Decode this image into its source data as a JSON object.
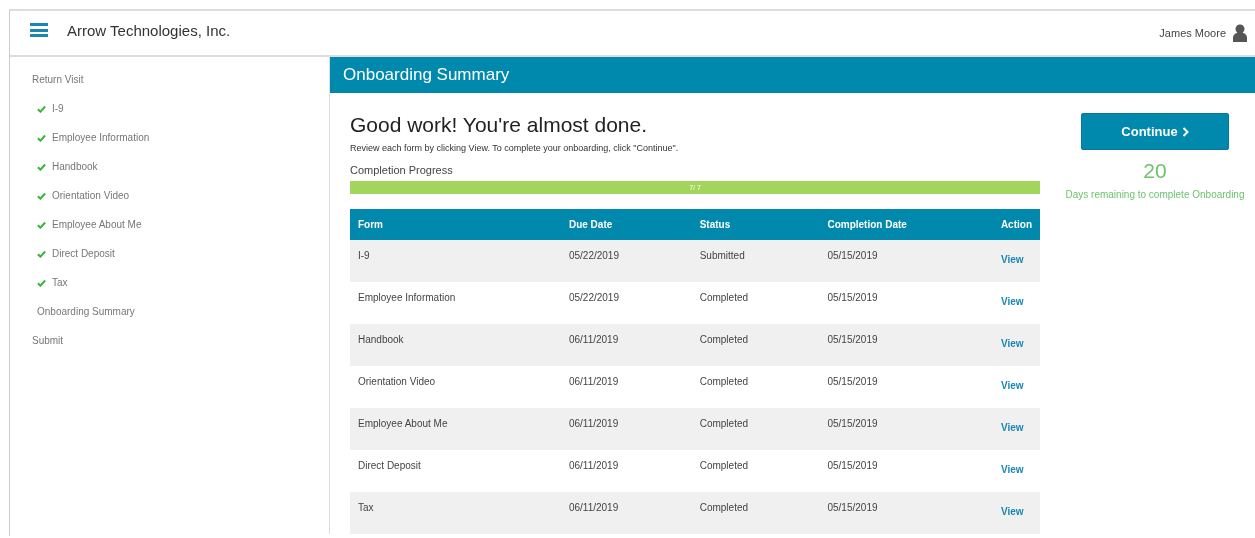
{
  "header": {
    "company": "Arrow Technologies, Inc.",
    "user": "James Moore"
  },
  "sidebar": {
    "items": [
      {
        "label": "Return Visit",
        "completed": false,
        "kind": "link"
      },
      {
        "label": "I-9",
        "completed": true,
        "kind": "step"
      },
      {
        "label": "Employee Information",
        "completed": true,
        "kind": "step"
      },
      {
        "label": "Handbook",
        "completed": true,
        "kind": "step"
      },
      {
        "label": "Orientation Video",
        "completed": true,
        "kind": "step"
      },
      {
        "label": "Employee About Me",
        "completed": true,
        "kind": "step"
      },
      {
        "label": "Direct Deposit",
        "completed": true,
        "kind": "step"
      },
      {
        "label": "Tax",
        "completed": true,
        "kind": "step"
      },
      {
        "label": "Onboarding Summary",
        "completed": false,
        "kind": "step"
      },
      {
        "label": "Submit",
        "completed": false,
        "kind": "link"
      }
    ]
  },
  "main": {
    "title": "Onboarding Summary",
    "heading": "Good work! You're almost done.",
    "instructions": "Review each form by clicking View. To complete your onboarding, click \"Continue\".",
    "progress": {
      "label": "Completion Progress",
      "level": 1,
      "reading": "7/ 7"
    },
    "table": {
      "columns": [
        "Form",
        "Due Date",
        "Status",
        "Completion Date",
        "Action"
      ],
      "rows": [
        [
          "I-9",
          "05/22/2019",
          "Submitted",
          "05/15/2019",
          "View"
        ],
        [
          "Employee Information",
          "05/22/2019",
          "Completed",
          "05/15/2019",
          "View"
        ],
        [
          "Handbook",
          "06/11/2019",
          "Completed",
          "05/15/2019",
          "View"
        ],
        [
          "Orientation Video",
          "06/11/2019",
          "Completed",
          "05/15/2019",
          "View"
        ],
        [
          "Employee About Me",
          "06/11/2019",
          "Completed",
          "05/15/2019",
          "View"
        ],
        [
          "Direct Deposit",
          "06/11/2019",
          "Completed",
          "05/15/2019",
          "View"
        ],
        [
          "Tax",
          "06/11/2019",
          "Completed",
          "05/15/2019",
          "View"
        ]
      ]
    },
    "continue_button": "Continue",
    "days_remaining": {
      "count": "20",
      "label": "Days remaining to complete Onboarding"
    }
  }
}
